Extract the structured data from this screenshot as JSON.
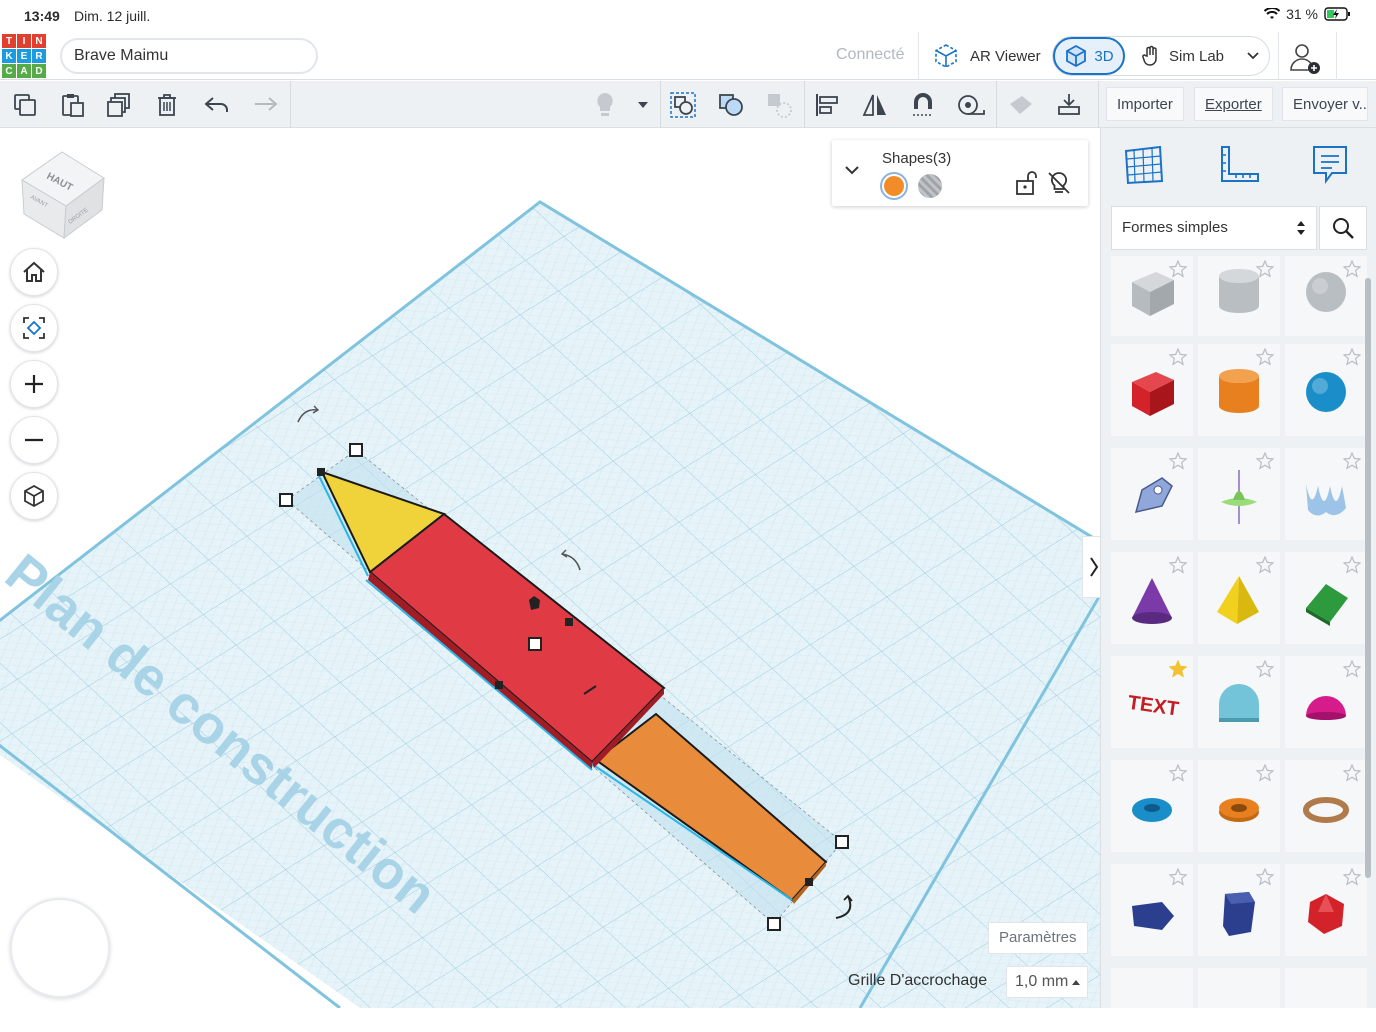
{
  "status": {
    "time": "13:49",
    "date": "Dim. 12 juill.",
    "battery": "31 %"
  },
  "header": {
    "logo_letters": [
      "T",
      "I",
      "N",
      "K",
      "E",
      "R",
      "C",
      "A",
      "D"
    ],
    "logo_colors": [
      "#e2402f",
      "#e2402f",
      "#e2402f",
      "#1c9be0",
      "#1c9be0",
      "#1c9be0",
      "#55ac47",
      "#55ac47",
      "#55ac47"
    ],
    "project_name": "Brave Maimu",
    "status": "Connecté",
    "ar_viewer": "AR Viewer",
    "mode_3d": "3D",
    "sim_lab": "Sim Lab"
  },
  "toolbar": {
    "import": "Importer",
    "export": "Exporter",
    "send": "Envoyer v..."
  },
  "workplane": {
    "plane_label": "Plan de construction",
    "viewcube_top": "HAUT",
    "viewcube_front": "AVANT",
    "viewcube_right": "DROITE"
  },
  "shapes_panel": {
    "title": "Shapes(3)",
    "solid_color": "#f28c28"
  },
  "settings": {
    "params": "Paramètres",
    "grid_label": "Grille D'accrochage",
    "grid_value": "1,0 mm"
  },
  "library": {
    "category": "Formes simples",
    "shapes": [
      {
        "name": "box-hole",
        "color": "#b9bec3"
      },
      {
        "name": "cylinder-hole",
        "color": "#b9bec3"
      },
      {
        "name": "sphere-hole",
        "color": "#b9bec3"
      },
      {
        "name": "box",
        "color": "#d3222a"
      },
      {
        "name": "cylinder",
        "color": "#e8801f"
      },
      {
        "name": "sphere",
        "color": "#1a8ec9"
      },
      {
        "name": "scribble",
        "color": "#8fa7db"
      },
      {
        "name": "shape-generator",
        "color": "#9adb7a"
      },
      {
        "name": "wave",
        "color": "#9cc3e8"
      },
      {
        "name": "cone",
        "color": "#7a3aa8"
      },
      {
        "name": "pyramid",
        "color": "#f2d11e"
      },
      {
        "name": "roof",
        "color": "#2e9a3e"
      },
      {
        "name": "text",
        "color": "#c41e24"
      },
      {
        "name": "half-cylinder",
        "color": "#73c4d8"
      },
      {
        "name": "half-sphere",
        "color": "#d61c8a"
      },
      {
        "name": "torus",
        "color": "#1a8ec9"
      },
      {
        "name": "tube",
        "color": "#e8801f"
      },
      {
        "name": "ring",
        "color": "#b07a4a"
      },
      {
        "name": "polygon",
        "color": "#2c3f8f"
      },
      {
        "name": "hexagonal-prism",
        "color": "#2c3f8f"
      },
      {
        "name": "icosahedron",
        "color": "#d3222a"
      }
    ]
  },
  "model": {
    "nose_color": "#f0d23a",
    "body_color": "#e03a45",
    "tail_color": "#e88b3b"
  }
}
